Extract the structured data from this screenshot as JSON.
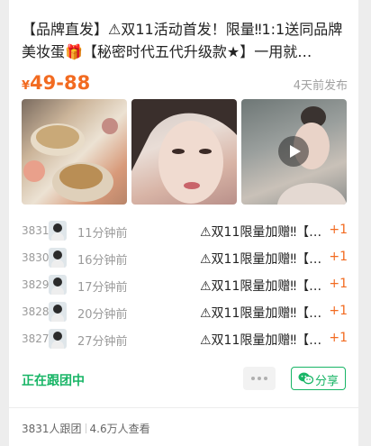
{
  "post": {
    "title": "【品牌直发】⚠双11活动首发！限量‼1:1送同品牌美妆蛋🎁【秘密时代五代升级款★】一用就…",
    "currency": "¥",
    "price_range": "49-88",
    "posted": "4天前发布",
    "images": [
      "cosmetic-product-photo",
      "model-portrait-photo",
      "makeup-video-thumbnail"
    ]
  },
  "join_list": [
    {
      "rank": "3831",
      "time": "11分钟前",
      "text": "⚠双11限量加赠‼【…",
      "qty": "+1"
    },
    {
      "rank": "3830",
      "time": "16分钟前",
      "text": "⚠双11限量加赠‼【…",
      "qty": "+1"
    },
    {
      "rank": "3829",
      "time": "17分钟前",
      "text": "⚠双11限量加赠‼【…",
      "qty": "+1"
    },
    {
      "rank": "3828",
      "time": "20分钟前",
      "text": "⚠双11限量加赠‼【…",
      "qty": "+1"
    },
    {
      "rank": "3827",
      "time": "27分钟前",
      "text": "⚠双11限量加赠‼【…",
      "qty": "+1"
    }
  ],
  "actions": {
    "status": "正在跟团中",
    "share_label": "分享",
    "more_icon": "ellipsis-icon",
    "share_icon": "wechat-icon"
  },
  "footer": {
    "joined": "3831人跟团",
    "views": "4.6万人查看"
  },
  "colors": {
    "price": "#f26b21",
    "accent_green": "#18b566"
  }
}
